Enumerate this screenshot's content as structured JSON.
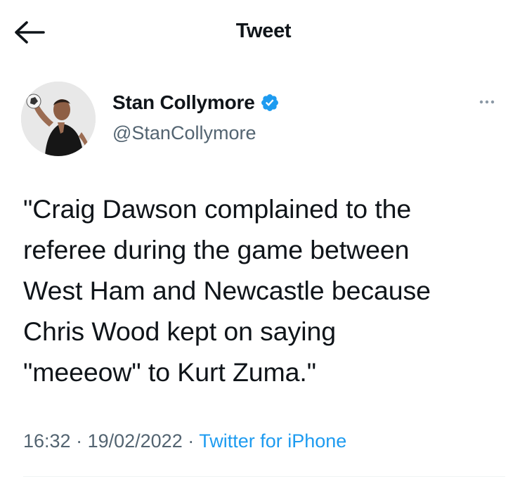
{
  "header": {
    "title": "Tweet",
    "back_icon": "arrow-left-icon"
  },
  "author": {
    "display_name": "Stan Collymore",
    "handle": "@StanCollymore",
    "verified": true,
    "verified_icon": "verified-badge-icon",
    "avatar_icon": "profile-avatar"
  },
  "menu": {
    "icon": "more-options-icon"
  },
  "tweet": {
    "text": "\"Craig Dawson complained to the\nreferee during the game between\nWest Ham and Newcastle because\nChris Wood kept on saying\n\"meeeow\" to Kurt Zuma.\""
  },
  "meta": {
    "time": "16:32",
    "separator": " · ",
    "date": "19/02/2022",
    "separator2": " · ",
    "source": "Twitter for iPhone"
  },
  "colors": {
    "text": "#0f1419",
    "secondary": "#536471",
    "accent": "#1d9bf0",
    "divider": "#eff3f4"
  }
}
